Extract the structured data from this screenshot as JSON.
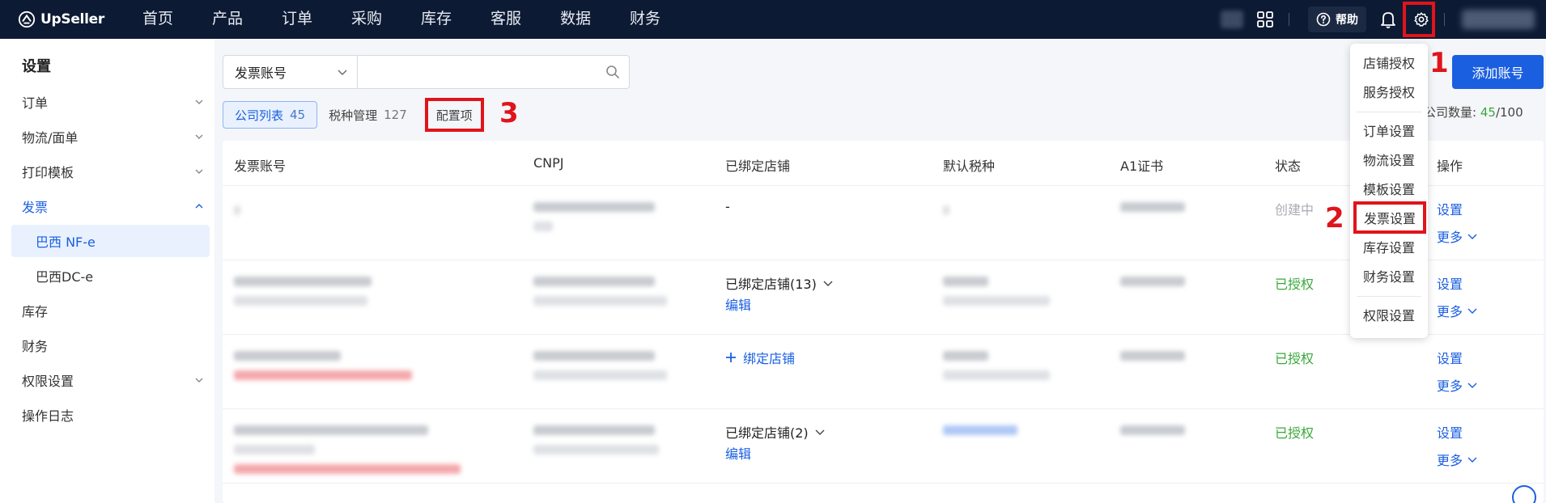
{
  "brand": {
    "name": "UpSeller"
  },
  "nav": [
    "首页",
    "产品",
    "订单",
    "采购",
    "库存",
    "客服",
    "数据",
    "财务"
  ],
  "topbar": {
    "help_label": "帮助"
  },
  "sidebar": {
    "title": "设置",
    "items": [
      {
        "label": "订单"
      },
      {
        "label": "物流/面单"
      },
      {
        "label": "打印模板"
      },
      {
        "label": "发票"
      },
      {
        "label": "巴西 NF-e"
      },
      {
        "label": "巴西DC-e"
      },
      {
        "label": "库存"
      },
      {
        "label": "财务"
      },
      {
        "label": "权限设置"
      },
      {
        "label": "操作日志"
      }
    ]
  },
  "filter": {
    "select_value": "发票账号",
    "search_placeholder": ""
  },
  "tabs": [
    {
      "label": "公司列表",
      "count": "45"
    },
    {
      "label": "税种管理",
      "count": "127"
    },
    {
      "label": "配置项"
    }
  ],
  "add_button": "添加账号",
  "quota": {
    "label": "公司数量:",
    "used": "45",
    "total": "/100"
  },
  "table": {
    "headers": [
      "发票账号",
      "CNPJ",
      "已绑定店铺",
      "默认税种",
      "A1证书",
      "状态",
      "操作"
    ],
    "rows": [
      {
        "bound": "-",
        "status": "创建中",
        "action_set": "设置",
        "action_more": "更多"
      },
      {
        "bound": "已绑定店铺(13)",
        "bound_edit": "编辑",
        "status": "已授权",
        "action_set": "设置",
        "action_more": "更多"
      },
      {
        "bound": "绑定店铺",
        "status": "已授权",
        "action_set": "设置",
        "action_more": "更多"
      },
      {
        "bound": "已绑定店铺(2)",
        "bound_edit": "编辑",
        "status": "已授权",
        "action_set": "设置",
        "action_more": "更多"
      }
    ]
  },
  "dropdown": {
    "items": [
      "店铺授权",
      "服务授权",
      "订单设置",
      "物流设置",
      "模板设置",
      "发票设置",
      "库存设置",
      "财务设置",
      "权限设置"
    ]
  },
  "annotations": [
    "1",
    "2",
    "3"
  ],
  "colors": {
    "accent": "#1a5fe0",
    "highlight": "#e0141b",
    "success": "#3aa83a",
    "topbar": "#0d1a33"
  }
}
